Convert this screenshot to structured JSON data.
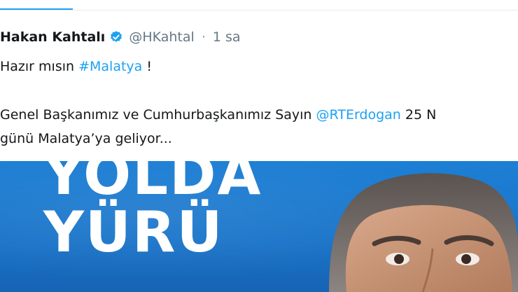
{
  "tweet": {
    "display_name": "Hakan Kahtalı",
    "handle": "@HKahtal",
    "separator": "·",
    "time": "1 sa",
    "line1_prefix": "Hazır mısın ",
    "hashtag": "#Malatya",
    "line1_suffix": " !",
    "line2_prefix": "Genel Başkanımız ve Cumhurbaşkanımız Sayın ",
    "mention": "@RTErdogan",
    "line2_suffix": " 25 N",
    "line3": "günü Malatya’ya geliyor..."
  },
  "media": {
    "slogan_line1": "YOLDA",
    "slogan_line2": "YÜRÜ",
    "background_color": "#1a74c9"
  },
  "icons": {
    "verified": "verified-badge-icon"
  },
  "colors": {
    "link": "#1da1f2",
    "muted": "#657786"
  }
}
